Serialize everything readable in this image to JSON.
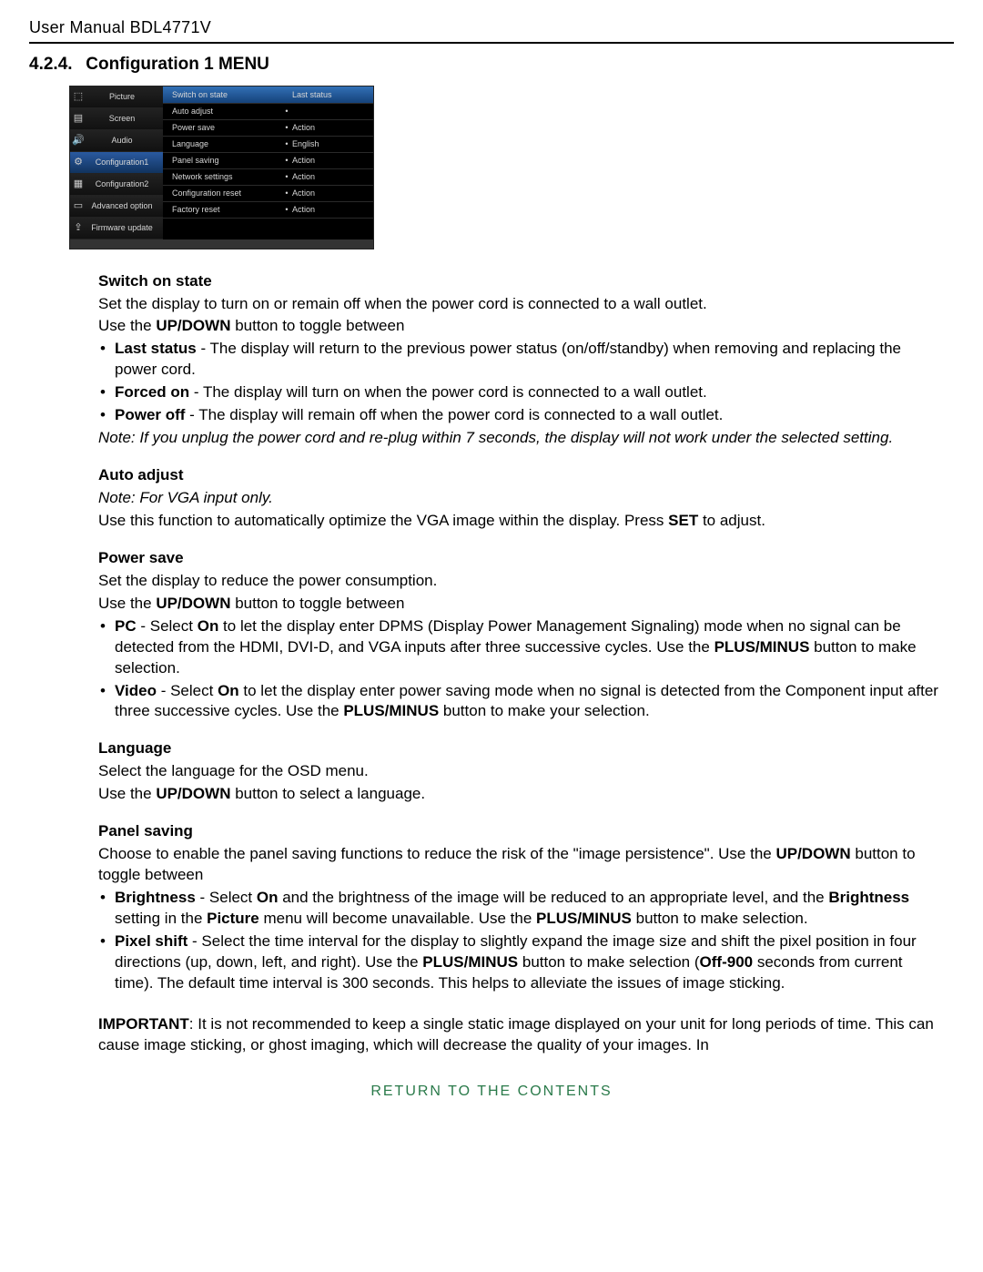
{
  "header": {
    "title": "User Manual BDL4771V"
  },
  "section": {
    "num": "4.2.4.",
    "title_prefix": "Configuration 1 ",
    "title_bold": "MENU"
  },
  "osd": {
    "left": [
      {
        "icon": "⬚",
        "label": "Picture"
      },
      {
        "icon": "▤",
        "label": "Screen"
      },
      {
        "icon": "🔊",
        "label": "Audio"
      },
      {
        "icon": "⚙",
        "label": "Configuration1",
        "selected": true
      },
      {
        "icon": "▦",
        "label": "Configuration2"
      },
      {
        "icon": "▭",
        "label": "Advanced option"
      },
      {
        "icon": "⇪",
        "label": "Firmware update"
      }
    ],
    "right": [
      {
        "name": "Switch on state",
        "bullet": "",
        "value": "Last status",
        "hi": true
      },
      {
        "name": "Auto adjust",
        "bullet": "•",
        "value": ""
      },
      {
        "name": "Power save",
        "bullet": "•",
        "value": "Action"
      },
      {
        "name": "Language",
        "bullet": "•",
        "value": "English"
      },
      {
        "name": "Panel saving",
        "bullet": "•",
        "value": "Action"
      },
      {
        "name": "Network settings",
        "bullet": "•",
        "value": "Action"
      },
      {
        "name": "Configuration reset",
        "bullet": "•",
        "value": "Action"
      },
      {
        "name": "Factory reset",
        "bullet": "•",
        "value": "Action"
      }
    ]
  },
  "switch_on_state": {
    "head": "Switch on state",
    "p1": "Set the display to turn on or remain off when the power cord is connected to a wall outlet.",
    "p2a": "Use the ",
    "p2b": "UP/DOWN",
    "p2c": " button to toggle between",
    "li1b": "Last status",
    "li1t": " - The display will return to the previous power status (on/off/standby) when removing and replacing the power cord.",
    "li2b": "Forced on",
    "li2t": " - The display will turn on when the power cord is connected to a wall outlet.",
    "li3b": "Power off",
    "li3t": " - The display will remain off when the power cord is connected to a wall outlet.",
    "note": "Note: If you unplug the power cord and re-plug within 7 seconds, the display will not work under the selected setting."
  },
  "auto_adjust": {
    "head": "Auto adjust",
    "note": "Note: For VGA input only.",
    "p1a": "Use this function to automatically optimize the VGA image within the display. Press ",
    "p1b": "SET",
    "p1c": " to adjust."
  },
  "power_save": {
    "head": "Power save",
    "p1": "Set the display to reduce the power consumption.",
    "p2a": "Use the ",
    "p2b": "UP/DOWN",
    "p2c": " button to toggle between",
    "li1b": "PC",
    "li1t1": " - Select ",
    "li1on": "On",
    "li1t2": " to let the display enter DPMS (Display Power Management Signaling) mode when no signal can be detected from the HDMI, DVI-D, and VGA inputs after three successive cycles. Use the ",
    "li1pm": "PLUS/MINUS",
    "li1t3": " button to make selection.",
    "li2b": "Video",
    "li2t1": " - Select ",
    "li2on": "On",
    "li2t2": " to let the display enter power saving mode when no signal is detected from the Component input after three successive cycles. Use the ",
    "li2pm": "PLUS/MINUS",
    "li2t3": " button to make your selection."
  },
  "language": {
    "head": "Language",
    "p1": "Select the language for the OSD menu.",
    "p2a": "Use the ",
    "p2b": "UP/DOWN",
    "p2c": " button to select a language."
  },
  "panel_saving": {
    "head": "Panel saving",
    "p1a": "Choose to enable the panel saving functions to reduce the risk of the \"image persistence\". Use the ",
    "p1b": "UP/DOWN",
    "p1c": " button to toggle between",
    "li1b": "Brightness",
    "li1t1": " - Select ",
    "li1on": "On",
    "li1t2": " and the brightness of the image will be reduced to an appropriate level, and the ",
    "li1br": "Brightness",
    "li1t3": " setting in the ",
    "li1pic": "Picture",
    "li1t4": " menu will become unavailable. Use the ",
    "li1pm": "PLUS/MINUS",
    "li1t5": " button to make selection.",
    "li2b": "Pixel shift",
    "li2t1": " - Select the time interval for the display to slightly expand the image size and shift the pixel position in four directions (up, down, left, and right). Use the ",
    "li2pm": "PLUS/MINUS",
    "li2t2": " button to make selection (",
    "li2off": "Off-900",
    "li2t3": " seconds from current time). The default time interval is 300 seconds. This helps to alleviate the issues of image sticking."
  },
  "important": {
    "b": "IMPORTANT",
    "t": ": It is not recommended to keep a single static image displayed on your unit for long periods of time. This can cause image sticking, or ghost imaging, which will decrease the quality of your images. In"
  },
  "footer": {
    "link": "RETURN TO THE CONTENTS"
  }
}
